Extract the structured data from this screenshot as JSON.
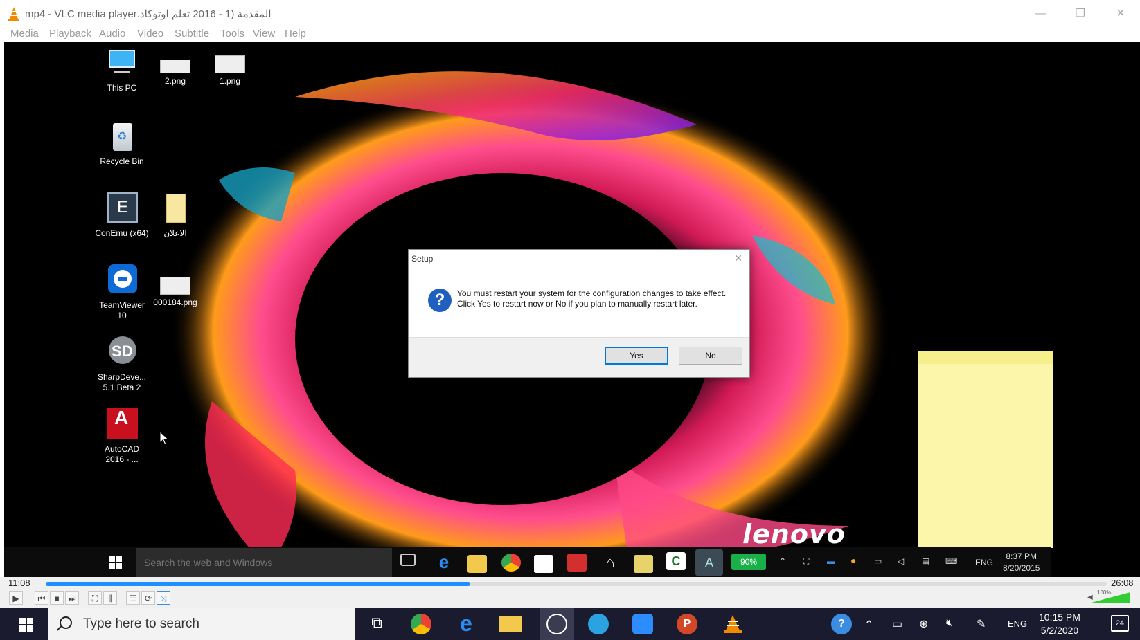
{
  "window": {
    "title": "المقدمة (1 - 2016 تعلم اوتوكاد.mp4 - VLC media player",
    "minimize": "—",
    "restore": "❐",
    "close": "✕"
  },
  "menu": [
    "Media",
    "Playback",
    "Audio",
    "Video",
    "Subtitle",
    "Tools",
    "View",
    "Help"
  ],
  "desktop_icons": [
    {
      "label": "This PC",
      "icon": "computer-icon"
    },
    {
      "label": "2.png",
      "icon": "image-file-icon"
    },
    {
      "label": "1.png",
      "icon": "image-file-icon"
    },
    {
      "label": "Recycle Bin",
      "icon": "recycle-bin-icon"
    },
    {
      "label": "ConEmu (x64)",
      "icon": "conemu-icon"
    },
    {
      "label": "الاعلان",
      "icon": "folder-icon"
    },
    {
      "label": "TeamViewer 10",
      "icon": "teamviewer-icon"
    },
    {
      "label": "000184.png",
      "icon": "image-file-icon"
    },
    {
      "label": "SharpDeve... 5.1 Beta 2",
      "icon": "sharpdevelop-icon"
    },
    {
      "label": "AutoCAD 2016 - ...",
      "icon": "autocad-icon"
    }
  ],
  "dialog": {
    "title": "Setup",
    "close": "✕",
    "icon": "question-icon",
    "icon_glyph": "?",
    "message": "You must restart your system for the configuration changes to take effect. Click Yes to restart now or No if you plan to manually restart later.",
    "yes_label": "Yes",
    "no_label": "No"
  },
  "wallpaper_brand": "lenovo",
  "inner_taskbar": {
    "search_placeholder": "Search the web and Windows",
    "battery": "90%",
    "lang": "ENG",
    "time": "8:37 PM",
    "date": "8/20/2015"
  },
  "player": {
    "elapsed": "11:08",
    "total": "26:08",
    "progress": 0.4,
    "volume_label": "100%",
    "play": "▶",
    "prev": "⏮",
    "stop": "■",
    "next": "⏭",
    "fullscreen": "⛶",
    "extended": "⫼",
    "playlist": "☰",
    "loop": "⟳",
    "shuffle": "⤨"
  },
  "host_taskbar": {
    "search_placeholder": "Type here to search",
    "lang": "ENG",
    "time": "10:15 PM",
    "date": "5/2/2020",
    "notifications": "24"
  },
  "colors": {
    "taskbar": "#1a1b2e",
    "accent": "#0078d7",
    "vlc_orange": "#f28a00",
    "seek_fill": "#1e90ff"
  }
}
